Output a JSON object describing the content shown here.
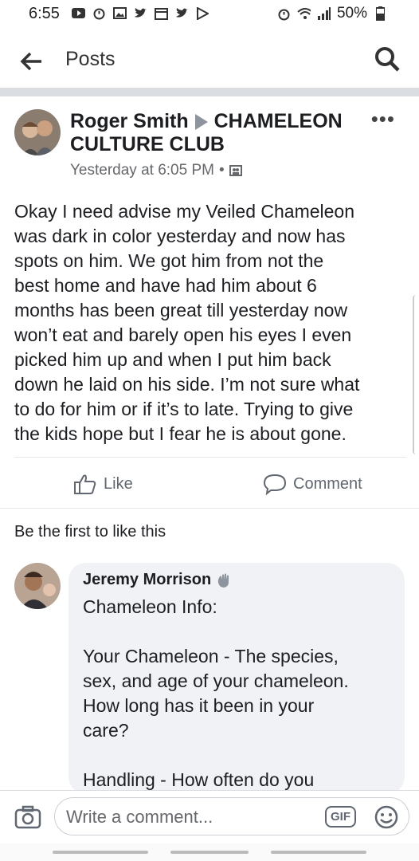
{
  "status_bar": {
    "time": "6:55",
    "battery": "50%"
  },
  "header": {
    "title": "Posts"
  },
  "post": {
    "author": "Roger Smith",
    "group": "CHAMELEON CULTURE CLUB",
    "timestamp": "Yesterday at 6:05 PM",
    "text_lines": [
      "Okay I need advise my Veiled Chameleon",
      "was dark in color yesterday and now has",
      "spots on him. We got him from not the",
      "best home and have had him about 6",
      "months has been great till yesterday now",
      "won’t eat and barely open his eyes I even",
      "picked him up and when I put him back",
      "down he laid on his side. I’m not sure what",
      "to do for him or if it’s to late. Trying to give",
      "the kids hope but I fear he is about gone."
    ],
    "like_label": "Like",
    "comment_label": "Comment",
    "reactions_text": "Be the first to like this"
  },
  "comment": {
    "author": "Jeremy Morrison",
    "text_lines": [
      "Chameleon Info:",
      "",
      "Your Chameleon - The species,",
      "sex, and age of your chameleon.",
      "How long has it been in your",
      "care?",
      "",
      "Handling - How often do you"
    ]
  },
  "composer": {
    "placeholder": "Write a comment...",
    "gif_label": "GIF"
  }
}
